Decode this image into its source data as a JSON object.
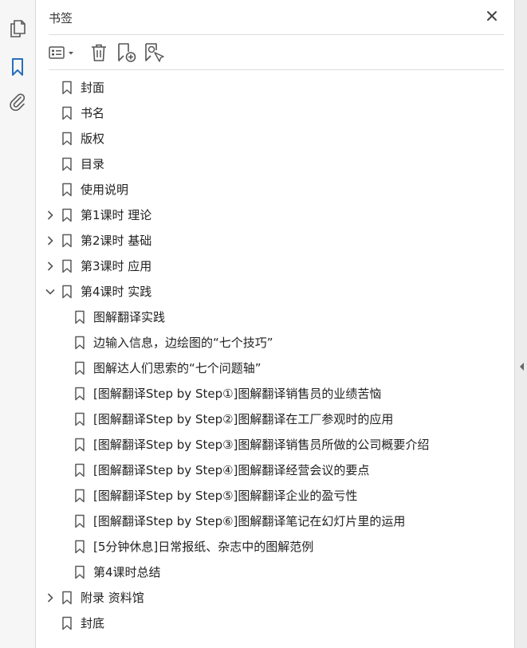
{
  "panel": {
    "title": "书签"
  },
  "rail": {
    "icons": [
      "pages-icon",
      "bookmark-icon",
      "attachment-icon"
    ]
  },
  "toolbar": {
    "icons": [
      "options-menu-icon",
      "delete-icon",
      "new-bookmark-icon",
      "find-bookmark-icon"
    ]
  },
  "colors": {
    "accent": "#2a6ebb",
    "icon": "#5a5a5a",
    "text": "#222222"
  },
  "bookmarks": [
    {
      "label": "封面",
      "level": 0,
      "state": "none"
    },
    {
      "label": "书名",
      "level": 0,
      "state": "none"
    },
    {
      "label": "版权",
      "level": 0,
      "state": "none"
    },
    {
      "label": "目录",
      "level": 0,
      "state": "none"
    },
    {
      "label": "使用说明",
      "level": 0,
      "state": "none"
    },
    {
      "label": "第1课时  理论",
      "level": 0,
      "state": "collapsed"
    },
    {
      "label": "第2课时  基础",
      "level": 0,
      "state": "collapsed"
    },
    {
      "label": "第3课时  应用",
      "level": 0,
      "state": "collapsed"
    },
    {
      "label": "第4课时  实践",
      "level": 0,
      "state": "expanded"
    },
    {
      "label": "图解翻译实践",
      "level": 1,
      "state": "none"
    },
    {
      "label": "边输入信息，边绘图的“七个技巧”",
      "level": 1,
      "state": "none"
    },
    {
      "label": "图解达人们思索的“七个问题轴”",
      "level": 1,
      "state": "none"
    },
    {
      "label": "[图解翻译Step by Step①]图解翻译销售员的业绩苦恼",
      "level": 1,
      "state": "none"
    },
    {
      "label": "[图解翻译Step by Step②]图解翻译在工厂参观时的应用",
      "level": 1,
      "state": "none"
    },
    {
      "label": "[图解翻译Step by Step③]图解翻译销售员所做的公司概要介绍",
      "level": 1,
      "state": "none"
    },
    {
      "label": "[图解翻译Step by Step④]图解翻译经营会议的要点",
      "level": 1,
      "state": "none"
    },
    {
      "label": "[图解翻译Step by Step⑤]图解翻译企业的盈亏性",
      "level": 1,
      "state": "none"
    },
    {
      "label": "[图解翻译Step by Step⑥]图解翻译笔记在幻灯片里的运用",
      "level": 1,
      "state": "none"
    },
    {
      "label": "[5分钟休息]日常报纸、杂志中的图解范例",
      "level": 1,
      "state": "none"
    },
    {
      "label": "第4课时总结",
      "level": 1,
      "state": "none"
    },
    {
      "label": "附录  资料馆",
      "level": 0,
      "state": "collapsed"
    },
    {
      "label": "封底",
      "level": 0,
      "state": "none"
    }
  ]
}
